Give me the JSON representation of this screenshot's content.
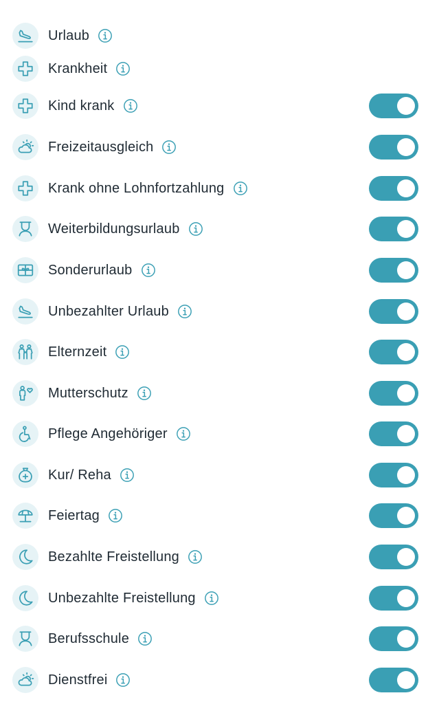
{
  "accent_color": "#3a9fb4",
  "icon_bg_color": "#e6f3f6",
  "items": [
    {
      "label": "Urlaub",
      "icon": "airplane-landing-icon",
      "toggle": null
    },
    {
      "label": "Krankheit",
      "icon": "medical-cross-icon",
      "toggle": null
    },
    {
      "label": "Kind krank",
      "icon": "medical-cross-icon",
      "toggle": true
    },
    {
      "label": "Freizeitausgleich",
      "icon": "sun-cloud-icon",
      "toggle": true
    },
    {
      "label": "Krank ohne Lohnfortzahlung",
      "icon": "medical-cross-icon",
      "toggle": true
    },
    {
      "label": "Weiterbildungsurlaub",
      "icon": "graduate-icon",
      "toggle": true
    },
    {
      "label": "Sonderurlaub",
      "icon": "gift-card-icon",
      "toggle": true
    },
    {
      "label": "Unbezahlter Urlaub",
      "icon": "airplane-landing-icon",
      "toggle": true
    },
    {
      "label": "Elternzeit",
      "icon": "parents-icon",
      "toggle": true
    },
    {
      "label": "Mutterschutz",
      "icon": "person-heart-icon",
      "toggle": true
    },
    {
      "label": "Pflege Angehöriger",
      "icon": "wheelchair-icon",
      "toggle": true
    },
    {
      "label": "Kur/ Reha",
      "icon": "medical-bag-icon",
      "toggle": true
    },
    {
      "label": "Feiertag",
      "icon": "beach-umbrella-icon",
      "toggle": true
    },
    {
      "label": "Bezahlte Freistellung",
      "icon": "moon-icon",
      "toggle": true
    },
    {
      "label": "Unbezahlte Freistellung",
      "icon": "moon-icon",
      "toggle": true
    },
    {
      "label": "Berufsschule",
      "icon": "graduate-icon",
      "toggle": true
    },
    {
      "label": "Dienstfrei",
      "icon": "sun-cloud-icon",
      "toggle": true
    }
  ]
}
